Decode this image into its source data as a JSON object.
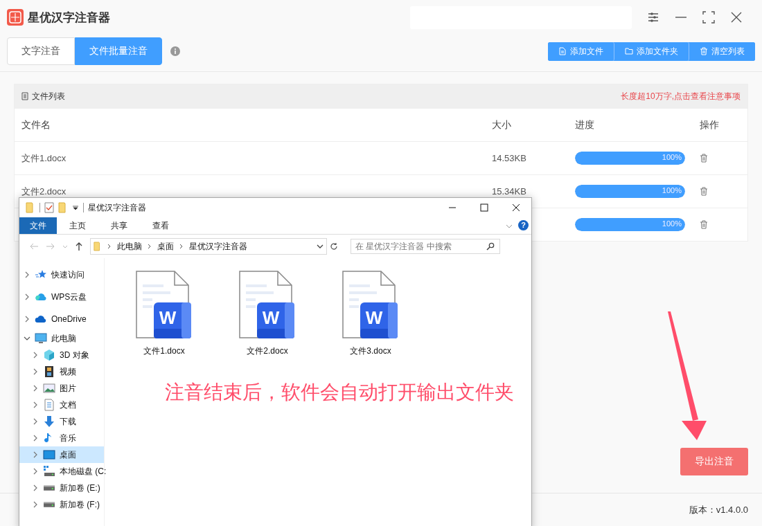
{
  "app": {
    "title": "星优汉字注音器",
    "tabs": [
      {
        "label": "文字注音",
        "selected": false
      },
      {
        "label": "文件批量注音",
        "selected": true
      }
    ],
    "toolbar": [
      {
        "label": "添加文件",
        "kind": "file"
      },
      {
        "label": "添加文件夹",
        "kind": "folder"
      },
      {
        "label": "清空列表",
        "kind": "trash"
      }
    ],
    "file_list": {
      "title": "文件列表",
      "notice": "长度超10万字,点击查看注意事项",
      "columns": [
        "文件名",
        "大小",
        "进度",
        "操作"
      ],
      "rows": [
        {
          "name": "文件1.docx",
          "size": "14.53KB",
          "level": 1,
          "reading": "100%"
        },
        {
          "name": "文件2.docx",
          "size": "15.34KB",
          "level": 1,
          "reading": "100%"
        },
        {
          "level": 1,
          "reading": "100%"
        }
      ]
    },
    "export_button": "导出注音",
    "version": "版本：v1.4.0.0"
  },
  "explorer": {
    "title": "星优汉字注音器",
    "ribbon_tabs": [
      {
        "label": "文件",
        "selected": true
      },
      {
        "label": "主页",
        "selected": false
      },
      {
        "label": "共享",
        "selected": false
      },
      {
        "label": "查看",
        "selected": false
      }
    ],
    "help": "?",
    "breadcrumb": [
      "此电脑",
      "桌面",
      "星优汉字注音器"
    ],
    "search": {
      "placeholder": "在 星优汉字注音器 中搜索"
    },
    "nav": [
      {
        "label": "快速访问",
        "kind": "star",
        "expanded": false,
        "selected": false
      },
      {
        "label": "WPS云盘",
        "kind": "cloud-color",
        "expanded": false,
        "selected": false
      },
      {
        "label": "OneDrive",
        "kind": "cloud",
        "expanded": false,
        "selected": false
      },
      {
        "label": "此电脑",
        "kind": "pc",
        "expanded": true,
        "selected": false,
        "children": [
          {
            "label": "3D 对象",
            "kind": "cube",
            "expanded": false,
            "selected": false
          },
          {
            "label": "视频",
            "kind": "film",
            "expanded": false,
            "selected": false
          },
          {
            "label": "图片",
            "kind": "image",
            "expanded": false,
            "selected": false
          },
          {
            "label": "文档",
            "kind": "doc",
            "expanded": false,
            "selected": false
          },
          {
            "label": "下载",
            "kind": "download",
            "expanded": false,
            "selected": false
          },
          {
            "label": "音乐",
            "kind": "music",
            "expanded": false,
            "selected": false
          },
          {
            "label": "桌面",
            "kind": "desktop",
            "expanded": false,
            "selected": true
          },
          {
            "label": "本地磁盘 (C:",
            "kind": "disk-windows",
            "expanded": false,
            "selected": false
          },
          {
            "label": "新加卷 (E:)",
            "kind": "disk",
            "expanded": false,
            "selected": false
          },
          {
            "label": "新加卷 (F:)",
            "kind": "disk",
            "expanded": false,
            "selected": false
          }
        ]
      }
    ],
    "files": [
      {
        "name": "文件1.docx",
        "badge": "W"
      },
      {
        "name": "文件2.docx",
        "badge": "W"
      },
      {
        "name": "文件3.docx",
        "badge": "W"
      }
    ]
  },
  "annotation": "注音结束后，软件会自动打开输出文件夹"
}
